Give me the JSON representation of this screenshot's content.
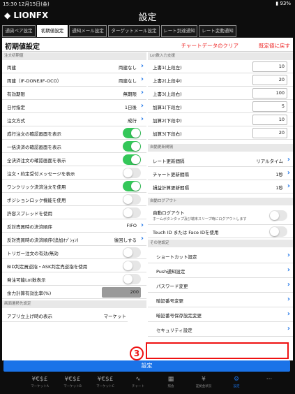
{
  "status": {
    "time": "15:30",
    "date": "12月15日(金)",
    "battery": "93%"
  },
  "app": {
    "logo": "LIONFX",
    "title": "設定"
  },
  "tabs": [
    {
      "label": "通貨ペア設定"
    },
    {
      "label": "初期値設定"
    },
    {
      "label": "通知メール設定"
    },
    {
      "label": "ターゲットメール設定"
    },
    {
      "label": "レート到達通知"
    },
    {
      "label": "レート変動通知"
    }
  ],
  "panel": {
    "heading": "初期値設定",
    "action1": "チャートデータのクリア",
    "action2": "既定値に戻す"
  },
  "sections": {
    "order": "注文初期値",
    "lot": "Lot数入力支援",
    "auto": "自動更新間隔",
    "autologout": "自動ログアウト",
    "other": "その他設定",
    "transition": "画面遷移先設定"
  },
  "left_rows": [
    {
      "label": "両建",
      "value": "両建なし"
    },
    {
      "label": "両建（IF-DONE/IF-OCO）",
      "value": "両建なし"
    },
    {
      "label": "有効期限",
      "value": "無期限"
    },
    {
      "label": "日付指定",
      "value": "1日後"
    },
    {
      "label": "注文方式",
      "value": "成行"
    },
    {
      "label": "成行注文の確認画面を表示",
      "value": ""
    },
    {
      "label": "一括決済の確認画面を表示",
      "value": ""
    },
    {
      "label": "全決済注文の確認画面を表示",
      "value": ""
    },
    {
      "label": "注文・約定受付メッセージを表示",
      "value": ""
    },
    {
      "label": "ワンクリック決済注文を使用",
      "value": ""
    },
    {
      "label": "ポジションロック機能を使用",
      "value": ""
    },
    {
      "label": "許容スプレッドを使用",
      "value": ""
    },
    {
      "label": "反対売買時の決済順序",
      "value": "FIFO"
    },
    {
      "label": "反対売買時の決済順序(追加ｵﾌﾟｼｮﾝ)",
      "value": "後回しする"
    },
    {
      "label": "トリガー注文の有効/無効",
      "value": ""
    },
    {
      "label": "BID判定買逆指・ASK判定売逆指を使用",
      "value": ""
    },
    {
      "label": "発注可能Lot数表示",
      "value": ""
    },
    {
      "label": "余力計算有効比率(%)",
      "value": "200"
    }
  ],
  "transition_row": {
    "label": "アプリ立上げ時の表示",
    "value": "マーケット"
  },
  "lot_rows": [
    {
      "label": "上書1(上段左)",
      "value": "10"
    },
    {
      "label": "上書2(上段中)",
      "value": "20"
    },
    {
      "label": "上書3(上段右)",
      "value": "100"
    },
    {
      "label": "加算1(下段左)",
      "value": "5"
    },
    {
      "label": "加算2(下段中)",
      "value": "10"
    },
    {
      "label": "加算3(下段右)",
      "value": "20"
    }
  ],
  "auto_rows": [
    {
      "label": "レート更新間隔",
      "value": "リアルタイム"
    },
    {
      "label": "チャート更新間隔",
      "value": "1秒"
    },
    {
      "label": "損益計算更新間隔",
      "value": "1秒"
    }
  ],
  "autologout_rows": [
    {
      "label": "自動ログアウト",
      "sub": "ホームボタンタップ及び端末スリープ時にログアウトします"
    },
    {
      "label": "Touch ID または Face IDを使用"
    }
  ],
  "other_rows": [
    {
      "label": "ショートカット設定"
    },
    {
      "label": "Push通知設定"
    },
    {
      "label": "パスワード変更"
    },
    {
      "label": "暗証番号変更"
    },
    {
      "label": "暗証番号保存設定変更"
    },
    {
      "label": "セキュリティ設定"
    }
  ],
  "callout_number": "3",
  "bottom_button": "設定",
  "nav": [
    {
      "label": "マーケットA",
      "icon": "¥€$£"
    },
    {
      "label": "マーケットB",
      "icon": "¥€$£"
    },
    {
      "label": "マーケットC",
      "icon": "¥€$£"
    },
    {
      "label": "チャート",
      "icon": "∿"
    },
    {
      "label": "照会",
      "icon": "▦"
    },
    {
      "label": "証拠金状況",
      "icon": "¥"
    },
    {
      "label": "設定",
      "icon": "⚙"
    },
    {
      "label": "",
      "icon": "···"
    }
  ]
}
